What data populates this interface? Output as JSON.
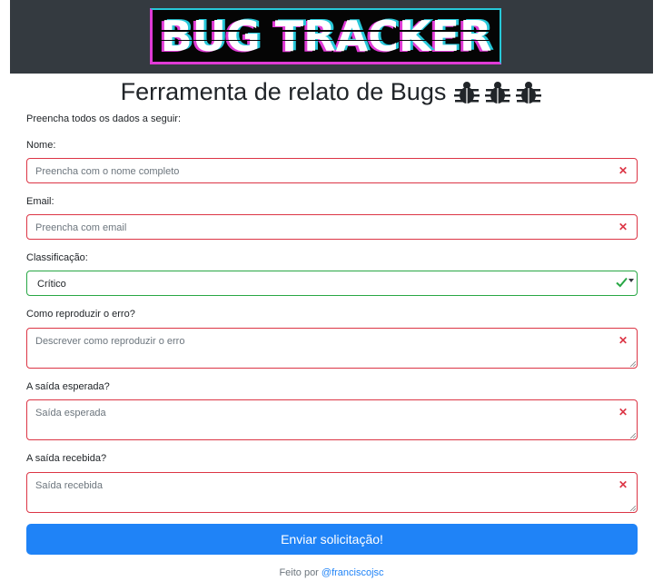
{
  "header": {
    "logo_text": "BUG TRACKER",
    "title": "Ferramenta de relato de Bugs",
    "title_icons": [
      "bug-icon",
      "bug-icon",
      "bug-icon"
    ]
  },
  "form": {
    "intro": "Preencha todos os dados a seguir:",
    "name": {
      "label": "Nome:",
      "placeholder": "Preencha com o nome completo",
      "value": "",
      "state": "invalid"
    },
    "email": {
      "label": "Email:",
      "placeholder": "Preencha com email",
      "value": "",
      "state": "invalid"
    },
    "classification": {
      "label": "Classificação:",
      "selected": "Crítico",
      "state": "valid"
    },
    "reproduce": {
      "label": "Como reproduzir o erro?",
      "placeholder": "Descrever como reproduzir o erro",
      "value": "",
      "state": "invalid"
    },
    "expected": {
      "label": "A saída esperada?",
      "placeholder": "Saída esperada",
      "value": "",
      "state": "invalid"
    },
    "received": {
      "label": "A saída recebida?",
      "placeholder": "Saída recebida",
      "value": "",
      "state": "invalid"
    },
    "submit_label": "Enviar solicitação!"
  },
  "footer": {
    "prefix": "Feito por",
    "link_text": "@franciscojsc"
  },
  "colors": {
    "header_bg": "#343a40",
    "invalid": "#dc3545",
    "valid": "#28a745",
    "primary": "#1f83f7",
    "logo_cyan": "#27c7d8",
    "logo_magenta": "#e03bd6"
  }
}
